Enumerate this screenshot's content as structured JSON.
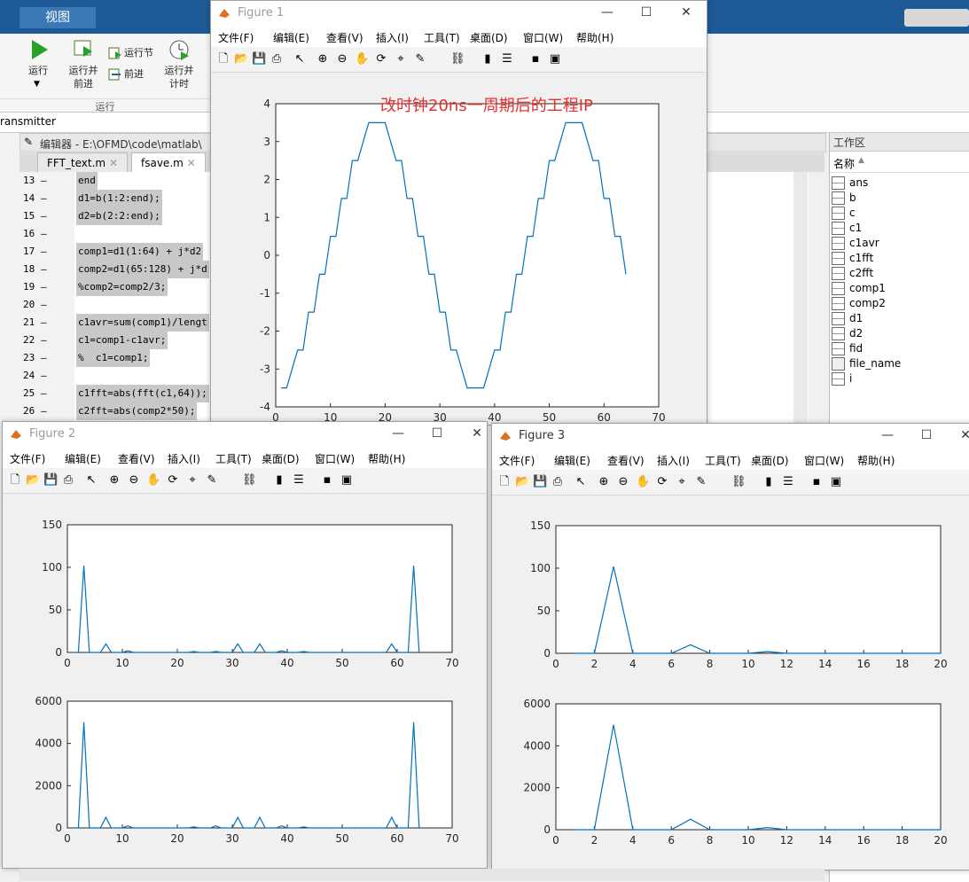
{
  "desktop": {
    "ribbon_tab": "视图",
    "buttons": {
      "run": "运行",
      "run_advance": "运行并\n前进",
      "run_section": "运行节",
      "advance": "前进",
      "run_time": "运行并\n计时"
    },
    "run_group_label": "运行",
    "path_text": "ransmitter",
    "editor_title": "编辑器 - E:\\OFMD\\code\\matlab\\",
    "editor_tabs": [
      "FFT_text.m",
      "fsave.m"
    ],
    "code_lines": [
      {
        "num": "13",
        "text": "end"
      },
      {
        "num": "14",
        "text": "d1=b(1:2:end);"
      },
      {
        "num": "15",
        "text": "d2=b(2:2:end);"
      },
      {
        "num": "16",
        "text": ""
      },
      {
        "num": "17",
        "text": "comp1=d1(1:64) + j*d2"
      },
      {
        "num": "18",
        "text": "comp2=d1(65:128) + j*d"
      },
      {
        "num": "19",
        "text": "%comp2=comp2/3;"
      },
      {
        "num": "20",
        "text": ""
      },
      {
        "num": "21",
        "text": "c1avr=sum(comp1)/lengt"
      },
      {
        "num": "22",
        "text": "c1=comp1-c1avr;"
      },
      {
        "num": "23",
        "text": "%  c1=comp1;"
      },
      {
        "num": "24",
        "text": ""
      },
      {
        "num": "25",
        "text": "c1fft=abs(fft(c1,64));"
      },
      {
        "num": "26",
        "text": "c2fft=abs(comp2*50);"
      }
    ],
    "workspace": {
      "title": "工作区",
      "column": "名称",
      "items": [
        "ans",
        "b",
        "c",
        "c1",
        "c1avr",
        "c1fft",
        "c2fft",
        "comp1",
        "comp2",
        "d1",
        "d2",
        "fid",
        "file_name",
        "i"
      ]
    }
  },
  "menus": [
    "文件(F)",
    "编辑(E)",
    "查看(V)",
    "插入(I)",
    "工具(T)",
    "桌面(D)",
    "窗口(W)",
    "帮助(H)"
  ],
  "figures": {
    "fig1": {
      "title": "Figure 1"
    },
    "fig2": {
      "title": "Figure 2"
    },
    "fig3": {
      "title": "Figure 3"
    }
  },
  "colors": {
    "line": "#0072bd",
    "annotation": "#e53030",
    "titlebar_blue": "#1e5a96"
  },
  "chart_data": [
    {
      "id": "fig1-plot",
      "type": "line",
      "title": "",
      "annotation": "改时钟20ns一周期后的工程IP",
      "xlim": [
        0,
        70
      ],
      "ylim": [
        -4,
        4
      ],
      "xticks": [
        0,
        10,
        20,
        30,
        40,
        50,
        60,
        70
      ],
      "yticks": [
        4,
        3,
        2,
        1,
        0,
        -1,
        -2,
        -3,
        -4
      ],
      "x": [
        1,
        2,
        3,
        4,
        5,
        6,
        7,
        8,
        9,
        10,
        11,
        12,
        13,
        14,
        15,
        16,
        17,
        18,
        19,
        20,
        21,
        22,
        23,
        24,
        25,
        26,
        27,
        28,
        29,
        30,
        31,
        32,
        33,
        34,
        35,
        36,
        37,
        38,
        39,
        40,
        41,
        42,
        43,
        44,
        45,
        46,
        47,
        48,
        49,
        50,
        51,
        52,
        53,
        54,
        55,
        56,
        57,
        58,
        59,
        60,
        61,
        62,
        63,
        64
      ],
      "y": [
        -3.5,
        -3.5,
        -3,
        -2.5,
        -2.5,
        -1.5,
        -1.5,
        -0.5,
        -0.5,
        0.5,
        0.5,
        1.5,
        1.5,
        2.5,
        2.5,
        3,
        3.5,
        3.5,
        3.5,
        3.5,
        3,
        2.5,
        2.5,
        1.5,
        1.5,
        0.5,
        0.5,
        -0.5,
        -0.5,
        -1.5,
        -1.5,
        -2.5,
        -2.5,
        -3,
        -3.5,
        -3.5,
        -3.5,
        -3.5,
        -3,
        -2.5,
        -2.5,
        -1.5,
        -1.5,
        -0.5,
        -0.5,
        0.5,
        0.5,
        1.5,
        1.5,
        2.5,
        2.5,
        3,
        3.5,
        3.5,
        3.5,
        3.5,
        3,
        2.5,
        2.5,
        1.5,
        1.5,
        0.5,
        0.5,
        -0.5
      ]
    },
    {
      "id": "fig2-top",
      "type": "line",
      "xlim": [
        0,
        70
      ],
      "ylim": [
        0,
        150
      ],
      "xticks": [
        0,
        10,
        20,
        30,
        40,
        50,
        60,
        70
      ],
      "yticks": [
        0,
        50,
        100,
        150
      ],
      "x": [
        1,
        2,
        3,
        4,
        5,
        6,
        7,
        8,
        9,
        10,
        11,
        12,
        13,
        14,
        15,
        16,
        17,
        18,
        19,
        20,
        21,
        22,
        23,
        24,
        25,
        26,
        27,
        28,
        29,
        30,
        31,
        32,
        33,
        34,
        35,
        36,
        37,
        38,
        39,
        40,
        41,
        42,
        43,
        44,
        45,
        46,
        47,
        48,
        49,
        50,
        51,
        52,
        53,
        54,
        55,
        56,
        57,
        58,
        59,
        60,
        61,
        62,
        63,
        64
      ],
      "y": [
        0,
        0,
        102,
        0,
        0,
        0,
        10,
        0,
        0,
        0,
        2,
        0,
        0,
        0,
        0,
        0,
        0,
        0,
        0,
        0,
        0,
        0,
        1,
        0,
        0,
        0,
        1,
        0,
        0,
        0,
        10,
        0,
        0,
        0,
        10,
        0,
        0,
        0,
        2,
        0,
        0,
        0,
        1,
        0,
        0,
        0,
        0,
        0,
        0,
        0,
        0,
        0,
        0,
        0,
        0,
        0,
        0,
        0,
        10,
        0,
        0,
        0,
        102,
        0
      ]
    },
    {
      "id": "fig2-bottom",
      "type": "line",
      "xlim": [
        0,
        70
      ],
      "ylim": [
        0,
        6000
      ],
      "xticks": [
        0,
        10,
        20,
        30,
        40,
        50,
        60,
        70
      ],
      "yticks": [
        0,
        2000,
        4000,
        6000
      ],
      "x": [
        1,
        2,
        3,
        4,
        5,
        6,
        7,
        8,
        9,
        10,
        11,
        12,
        13,
        14,
        15,
        16,
        17,
        18,
        19,
        20,
        21,
        22,
        23,
        24,
        25,
        26,
        27,
        28,
        29,
        30,
        31,
        32,
        33,
        34,
        35,
        36,
        37,
        38,
        39,
        40,
        41,
        42,
        43,
        44,
        45,
        46,
        47,
        48,
        49,
        50,
        51,
        52,
        53,
        54,
        55,
        56,
        57,
        58,
        59,
        60,
        61,
        62,
        63,
        64
      ],
      "y": [
        0,
        0,
        5000,
        0,
        0,
        0,
        500,
        0,
        0,
        0,
        100,
        0,
        0,
        0,
        0,
        0,
        0,
        0,
        0,
        0,
        0,
        0,
        50,
        0,
        0,
        0,
        100,
        0,
        0,
        0,
        500,
        0,
        0,
        0,
        500,
        0,
        0,
        0,
        100,
        0,
        0,
        0,
        50,
        0,
        0,
        0,
        0,
        0,
        0,
        0,
        0,
        0,
        0,
        0,
        0,
        0,
        0,
        0,
        500,
        0,
        0,
        0,
        5000,
        0
      ]
    },
    {
      "id": "fig3-top",
      "type": "line",
      "xlim": [
        0,
        20
      ],
      "ylim": [
        0,
        150
      ],
      "xticks": [
        0,
        2,
        4,
        6,
        8,
        10,
        12,
        14,
        16,
        18,
        20
      ],
      "yticks": [
        0,
        50,
        100,
        150
      ],
      "x": [
        1,
        2,
        3,
        4,
        5,
        6,
        7,
        8,
        9,
        10,
        11,
        12,
        13,
        14,
        15,
        16,
        17,
        18,
        19,
        20
      ],
      "y": [
        0,
        0,
        102,
        0,
        0,
        0,
        10,
        0,
        0,
        0,
        2,
        0,
        0,
        0,
        0,
        0,
        0,
        0,
        0,
        0
      ]
    },
    {
      "id": "fig3-bottom",
      "type": "line",
      "xlim": [
        0,
        20
      ],
      "ylim": [
        0,
        6000
      ],
      "xticks": [
        0,
        2,
        4,
        6,
        8,
        10,
        12,
        14,
        16,
        18,
        20
      ],
      "yticks": [
        0,
        2000,
        4000,
        6000
      ],
      "x": [
        1,
        2,
        3,
        4,
        5,
        6,
        7,
        8,
        9,
        10,
        11,
        12,
        13,
        14,
        15,
        16,
        17,
        18,
        19,
        20
      ],
      "y": [
        0,
        0,
        5000,
        0,
        0,
        0,
        500,
        0,
        0,
        0,
        100,
        0,
        0,
        0,
        0,
        0,
        0,
        0,
        0,
        0
      ]
    }
  ]
}
